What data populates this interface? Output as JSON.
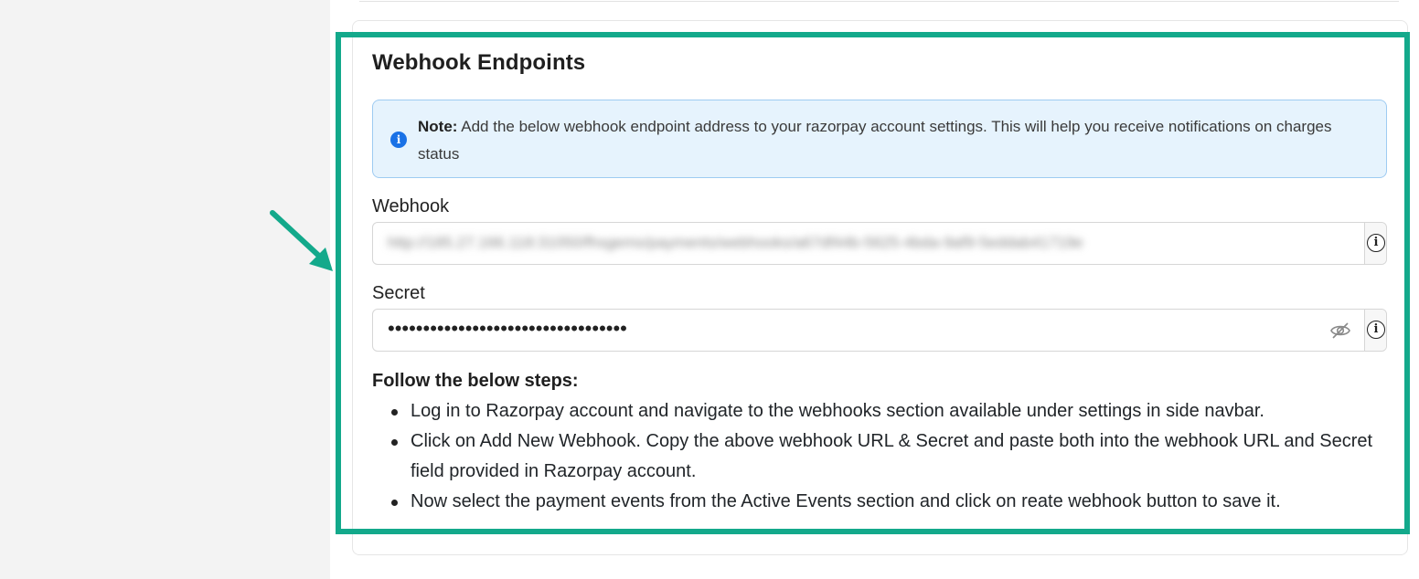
{
  "section": {
    "title": "Webhook Endpoints"
  },
  "note": {
    "label": "Note:",
    "text": "Add the below webhook endpoint address to your razorpay account settings. This will help you receive notifications on charges status",
    "icon": "info-icon"
  },
  "webhook": {
    "label": "Webhook",
    "value": "http://185.27.166.118:31050/fhsgems/payments/webhooks/a67df44b-5625-4bda-9af9-5eddab41719e",
    "info_icon": "info-icon"
  },
  "secret": {
    "label": "Secret",
    "value": "••••••••••••••••••••••••••••••••••",
    "toggle_icon": "eye-slash-icon",
    "info_icon": "info-icon"
  },
  "steps": {
    "title": "Follow the below steps:",
    "items": [
      "Log in to Razorpay account and navigate to the webhooks section available under settings in side navbar.",
      "Click on Add New Webhook. Copy the above webhook URL & Secret and paste both into the webhook URL and Secret field provided in Razorpay account.",
      "Now select the payment events from the Active Events section and click on reate webhook button to save it."
    ]
  },
  "colors": {
    "highlight": "#13a98b",
    "note_bg": "#e6f3fd",
    "note_border": "#9ecbf2",
    "note_icon": "#1971e6"
  }
}
